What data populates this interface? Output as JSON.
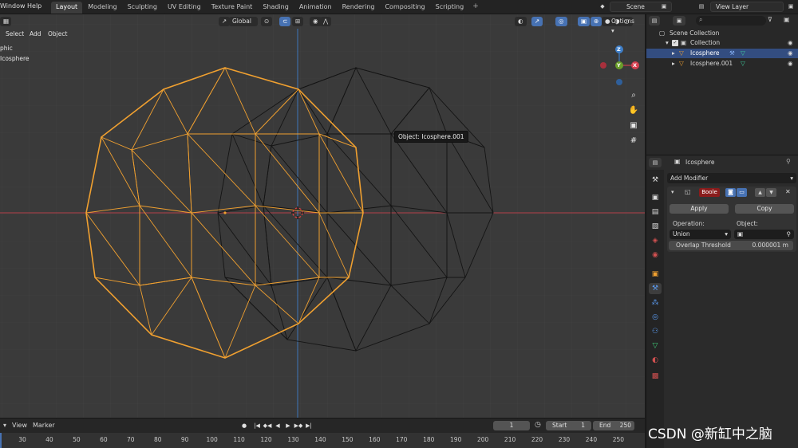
{
  "topbar": {
    "menu_window": "Window",
    "menu_help": "Help",
    "workspaces": [
      "Layout",
      "Modeling",
      "Sculpting",
      "UV Editing",
      "Texture Paint",
      "Shading",
      "Animation",
      "Rendering",
      "Compositing",
      "Scripting"
    ],
    "active_workspace": "Layout",
    "add_workspace": "+",
    "scene": "Scene",
    "view_layer": "View Layer"
  },
  "viewport_header": {
    "menu_select": "Select",
    "menu_add": "Add",
    "menu_object": "Object",
    "transform_orientation": "Global",
    "options": "Options"
  },
  "viewport": {
    "overlay_line1": "phic",
    "overlay_line2": "Icosphere",
    "tooltip": "Object: Icosphere.001",
    "gizmo_z": "Z",
    "gizmo_y": "Y",
    "gizmo_x": "X",
    "colors": {
      "selected_wire": "#f0a030",
      "unselected_wire": "#141414",
      "x_axis": "#b4404a",
      "y_axis": "#3f7fc9"
    }
  },
  "timeline": {
    "menu_view": "View",
    "menu_marker": "Marker",
    "current_frame": "1",
    "start_label": "Start",
    "start_value": "1",
    "end_label": "End",
    "end_value": "250",
    "ticks": [
      "30",
      "40",
      "50",
      "60",
      "70",
      "80",
      "90",
      "100",
      "110",
      "120",
      "130",
      "140",
      "150",
      "160",
      "170",
      "180",
      "190",
      "200",
      "210",
      "220",
      "230",
      "240",
      "250"
    ]
  },
  "outliner": {
    "scene_collection": "Scene Collection",
    "collection": "Collection",
    "items": [
      {
        "name": "Icosphere",
        "selected": true
      },
      {
        "name": "Icosphere.001",
        "selected": false
      }
    ]
  },
  "properties": {
    "object_name": "Icosphere",
    "add_modifier": "Add Modifier",
    "modifier_name": "Boole",
    "apply": "Apply",
    "copy": "Copy",
    "operation_label": "Operation:",
    "object_label": "Object:",
    "operation_value": "Union",
    "overlap_label": "Overlap Threshold",
    "overlap_value": "0.000001 m"
  },
  "watermark": "CSDN @新缸中之脑"
}
